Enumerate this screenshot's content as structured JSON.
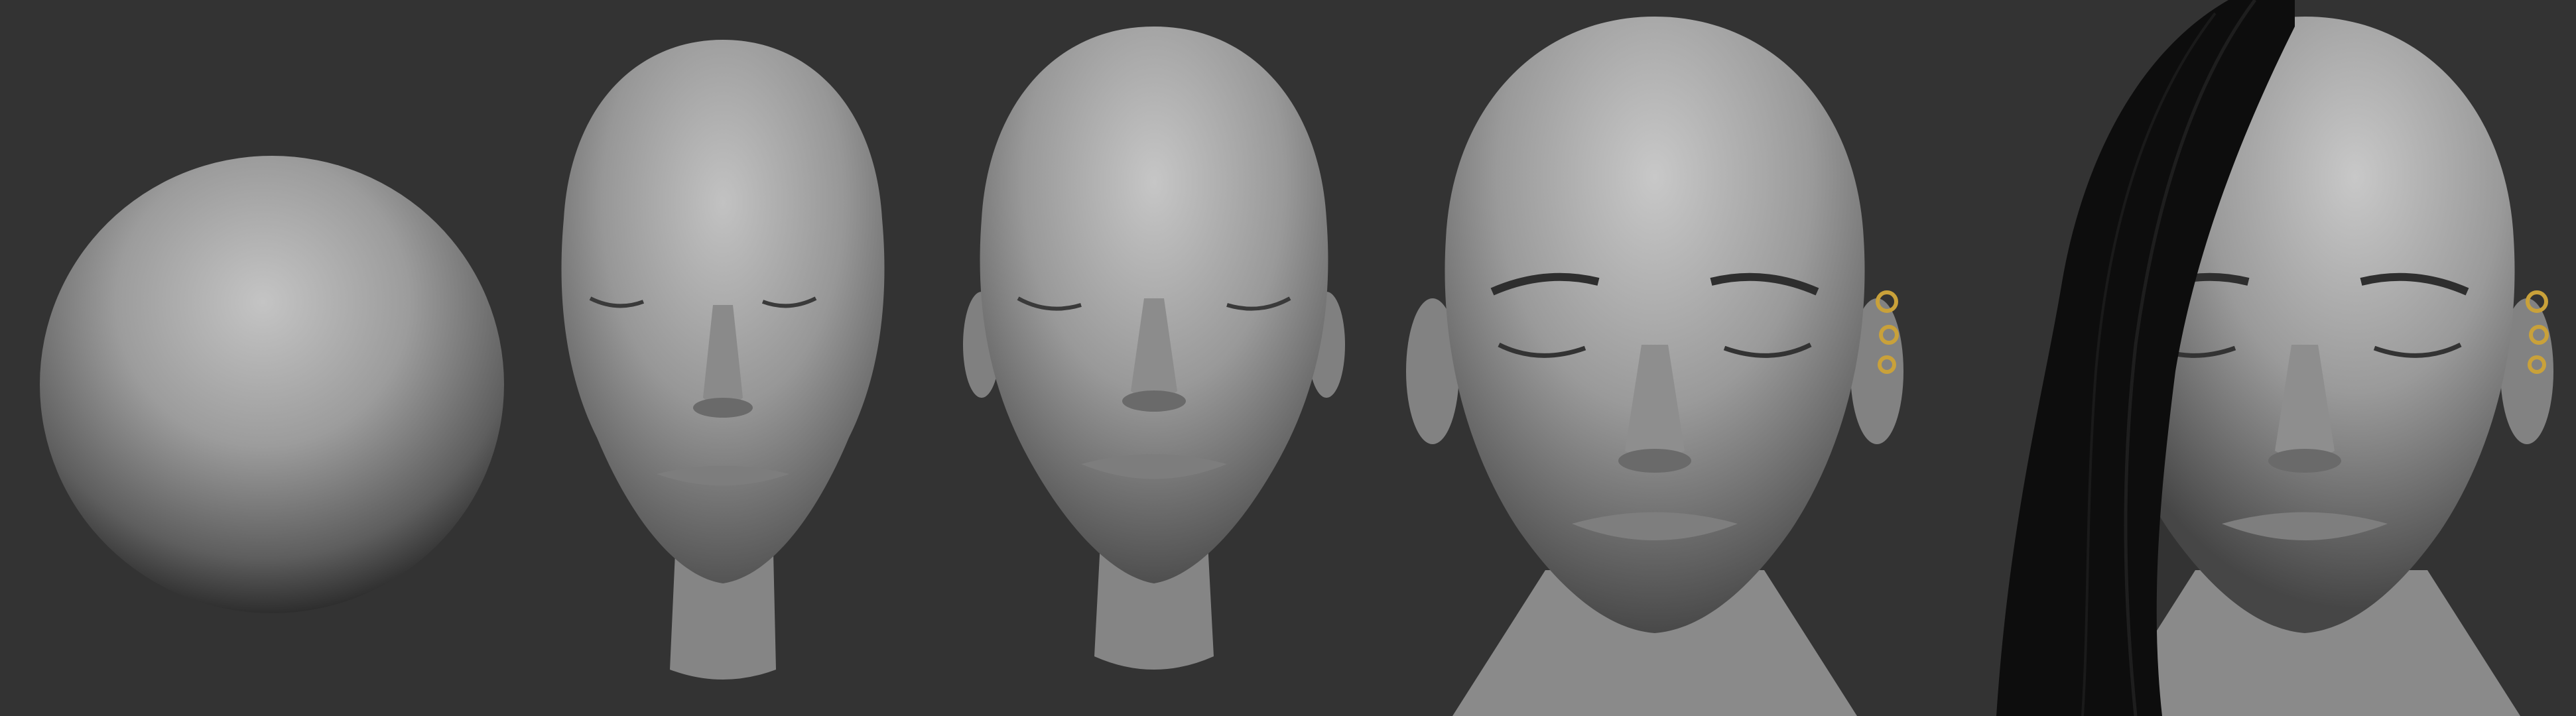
{
  "scene": {
    "background_color": "#333333",
    "clay_color": "#9a9a9a",
    "earring_color": "#c9a13a",
    "hair_color": "#0d0d0d"
  },
  "stages": [
    {
      "subject": "sphere",
      "icon": "sphere-primitive"
    },
    {
      "subject": "head",
      "icon": "head-blockout",
      "eyes": "closed"
    },
    {
      "subject": "head",
      "icon": "head-refined",
      "eyes": "closed",
      "ears": true
    },
    {
      "subject": "head",
      "icon": "head-detailed",
      "eyes": "closed",
      "ears": true,
      "neck": true,
      "earrings": true
    },
    {
      "subject": "head",
      "icon": "head-final",
      "eyes": "closed",
      "ears": true,
      "neck": true,
      "earrings": true,
      "hair": "long, one side"
    }
  ]
}
